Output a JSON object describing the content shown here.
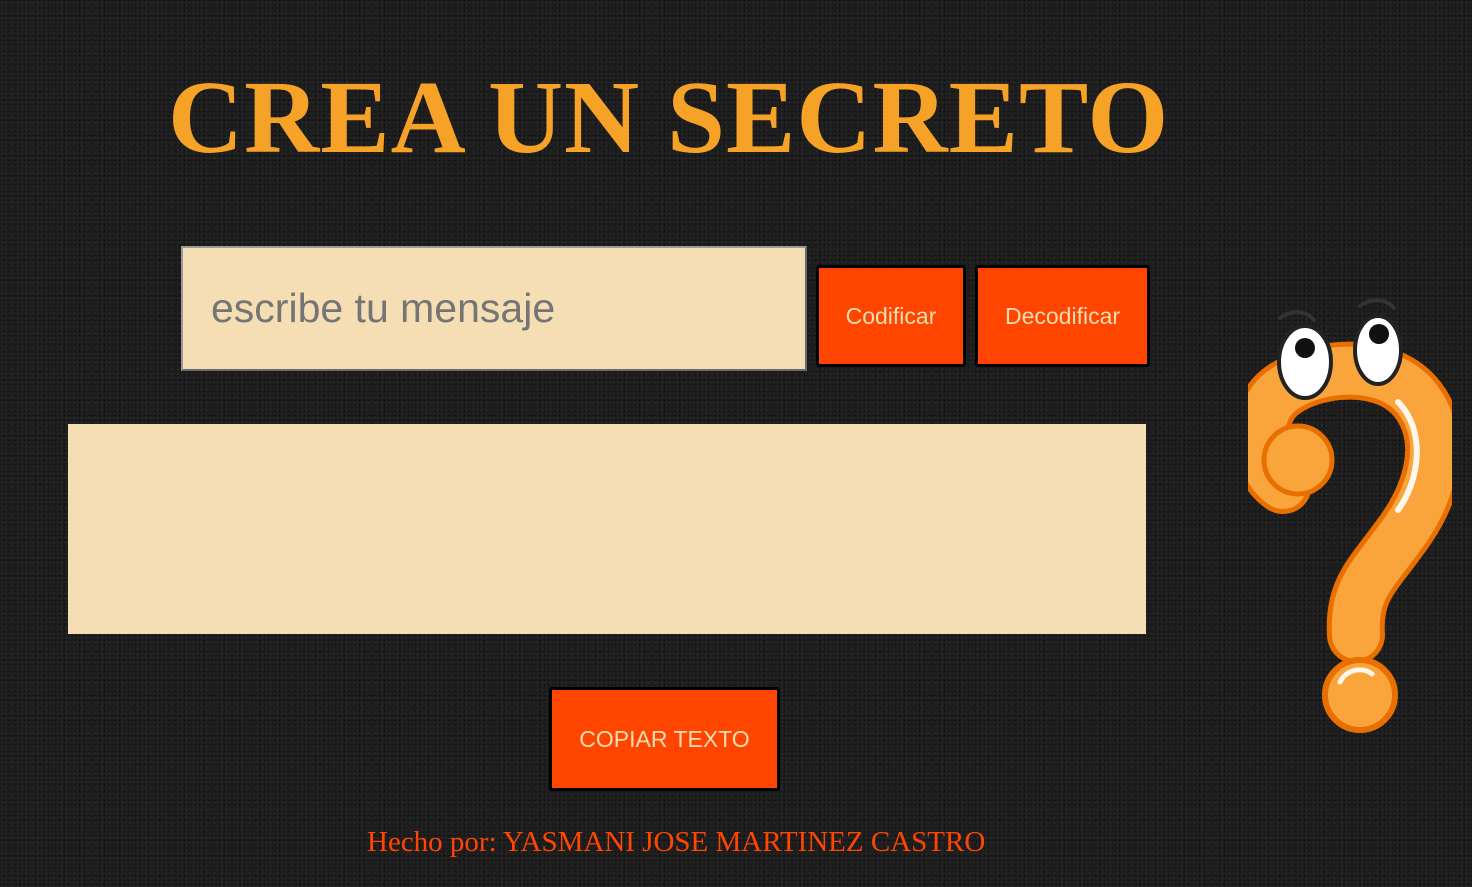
{
  "header": {
    "title": "CREA UN SECRETO"
  },
  "input": {
    "placeholder": "escribe tu mensaje",
    "value": ""
  },
  "buttons": {
    "encode_label": "Codificar",
    "decode_label": "Decodificar",
    "copy_label": "COPIAR TEXTO"
  },
  "output": {
    "text": ""
  },
  "footer": {
    "credit": "Hecho por: YASMANI JOSE MARTINEZ CASTRO"
  },
  "illustration": {
    "icon": "question-mark-with-eyes-icon"
  },
  "colors": {
    "title": "#f5a227",
    "button_bg": "#ff4500",
    "button_text": "#f5deb3",
    "field_bg": "#f5deb3",
    "footer_text": "#ff4500",
    "page_bg": "#1c1c1c"
  }
}
